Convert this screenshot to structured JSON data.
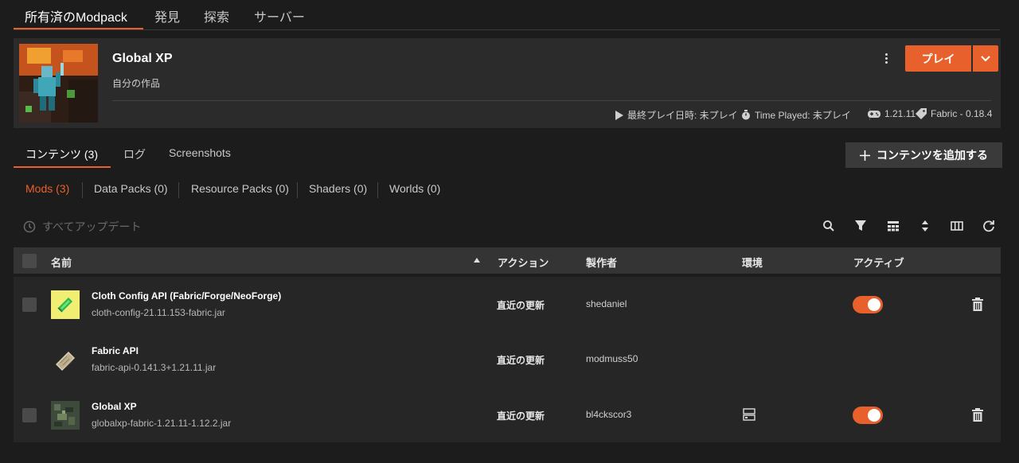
{
  "top_tabs": [
    "所有済のModpack",
    "発見",
    "探索",
    "サーバー"
  ],
  "pack": {
    "title": "Global XP",
    "subtitle": "自分の作品",
    "play_label": "プレイ",
    "last_played": "最終プレイ日時: 未プレイ",
    "time_played": "Time Played: 未プレイ",
    "mc_version": "1.21.11",
    "loader": "Fabric - 0.18.4"
  },
  "sub_tabs": [
    "コンテンツ (3)",
    "ログ",
    "Screenshots"
  ],
  "add_content_label": "コンテンツを追加する",
  "filters": [
    "Mods (3)",
    "Data Packs (0)",
    "Resource Packs (0)",
    "Shaders (0)",
    "Worlds (0)"
  ],
  "update_all_label": "すべてアップデート",
  "columns": {
    "name": "名前",
    "action": "アクション",
    "author": "製作者",
    "env": "環境",
    "active": "アクティブ"
  },
  "mods": [
    {
      "name": "Cloth Config API (Fabric/Forge/NeoForge)",
      "file": "cloth-config-21.11.153-fabric.jar",
      "action": "直近の更新",
      "author": "shedaniel",
      "active": true,
      "icon": "cloth-config-icon"
    },
    {
      "name": "Fabric API",
      "file": "fabric-api-0.141.3+1.21.11.jar",
      "action": "直近の更新",
      "author": "modmuss50",
      "active": null,
      "icon": "fabric-api-icon"
    },
    {
      "name": "Global XP",
      "file": "globalxp-fabric-1.21.11-1.12.2.jar",
      "action": "直近の更新",
      "author": "bl4ckscor3",
      "active": true,
      "icon": "global-xp-icon"
    }
  ],
  "colors": {
    "accent": "#e8612c",
    "background": "#1c1c1c",
    "panel": "#2b2b2b"
  }
}
